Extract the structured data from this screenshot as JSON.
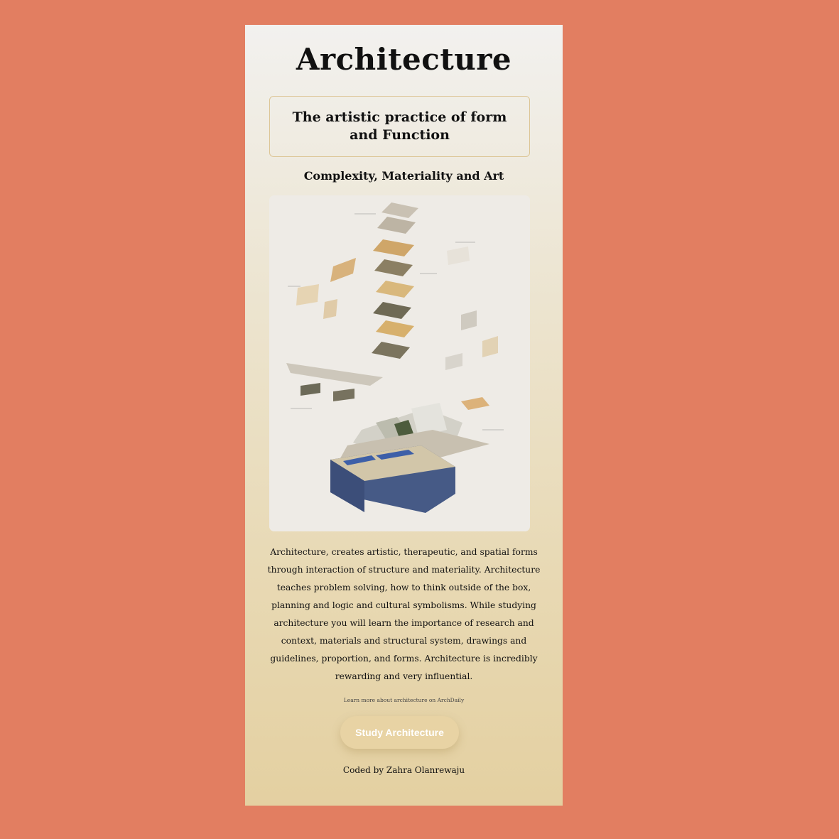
{
  "header": {
    "title": "Architecture"
  },
  "intro": {
    "subtitle": "The artistic practice of form and Function",
    "tagline": "Complexity, Materiality and Art"
  },
  "content": {
    "paragraph": "Architecture, creates artistic, therapeutic, and spatial forms through interaction of structure and materiality. Architecture teaches problem solving, how to think outside of the box, planning and logic and cultural symbolisms. While studying architecture you will learn the importance of research and context, materials and structural system, drawings and guidelines, proportion, and forms. Architecture is incredibly rewarding and very influential.",
    "link_text": "Learn more about architecture on ArchDaily"
  },
  "cta": {
    "button_label": "Study Architecture"
  },
  "footer": {
    "credit": "Coded by Zahra Olanrewaju"
  },
  "colors": {
    "page_background": "#e27e61",
    "card_gradient_top": "#f2f1ef",
    "card_gradient_bottom": "#e4d0a1",
    "button_fill": "#e8d3a4"
  }
}
